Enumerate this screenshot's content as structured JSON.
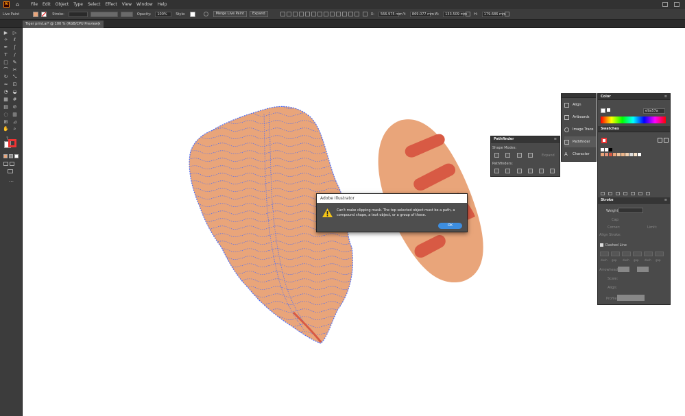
{
  "app": {
    "logo": "Ai"
  },
  "menu": {
    "items": [
      "File",
      "Edit",
      "Object",
      "Type",
      "Select",
      "Effect",
      "View",
      "Window",
      "Help"
    ]
  },
  "control_bar": {
    "selection_label": "Live Paint",
    "stroke_label": "Stroke:",
    "opacity_label": "Opacity:",
    "opacity_value": "100%",
    "style_label": "Style:",
    "merge_live_paint": "Merge Live Paint",
    "expand": "Expand",
    "x_label": "X:",
    "x_value": "566.975 mm",
    "y_label": "Y:",
    "y_value": "869.077 mm",
    "w_label": "W:",
    "w_value": "133.509 mm",
    "h_label": "H:",
    "h_value": "179.686 mm"
  },
  "document": {
    "tab_title": "Tiger print.ai* @ 100 % (RGB/CPU Preview)",
    "close": "×"
  },
  "pathfinder": {
    "title": "Pathfinder",
    "shape_modes": "Shape Modes:",
    "expand": "Expand",
    "pathfinders": "Pathfinders:"
  },
  "collapsed_panels": [
    "Align",
    "Artboards",
    "Image Trace",
    "Pathfinder",
    "Character"
  ],
  "color_panel": {
    "title": "Color",
    "hex": "e9a57a"
  },
  "swatches_panel": {
    "title": "Swatches"
  },
  "stroke_panel": {
    "title": "Stroke",
    "weight_label": "Weight:",
    "cap_label": "Cap:",
    "corner_label": "Corner:",
    "limit_label": "Limit:",
    "align_label": "Align Stroke:",
    "dashed_label": "Dashed Line",
    "dash_labels": [
      "dash",
      "gap",
      "dash",
      "gap",
      "dash",
      "gap"
    ],
    "arrowheads_label": "Arrowheads:",
    "scale_label": "Scale:",
    "align2_label": "Align:",
    "profile_label": "Profile:"
  },
  "dialog": {
    "title": "Adobe Illustrator",
    "message": "Can't make clipping mask. The top selected object must be a path, a compound shape, a text object, or a group of those.",
    "ok": "OK"
  },
  "colors": {
    "artwork_fill": "#e9a57a",
    "stripe": "#d85a44",
    "selection": "#4a6cf7",
    "ui_dark": "#323232",
    "ok_button": "#3d8ee0"
  },
  "icons": [
    "home-icon",
    "selection-tool-icon",
    "direct-selection-tool-icon",
    "pen-tool-icon",
    "type-tool-icon",
    "rectangle-tool-icon",
    "paintbrush-tool-icon",
    "eraser-tool-icon",
    "rotate-tool-icon",
    "scale-tool-icon",
    "warp-tool-icon",
    "shape-builder-tool-icon",
    "gradient-tool-icon",
    "eyedropper-tool-icon",
    "symbol-sprayer-icon",
    "graph-tool-icon",
    "artboard-tool-icon",
    "hand-tool-icon",
    "zoom-tool-icon",
    "warning-icon",
    "stroke-swatch-icon",
    "fill-swatch-icon"
  ]
}
